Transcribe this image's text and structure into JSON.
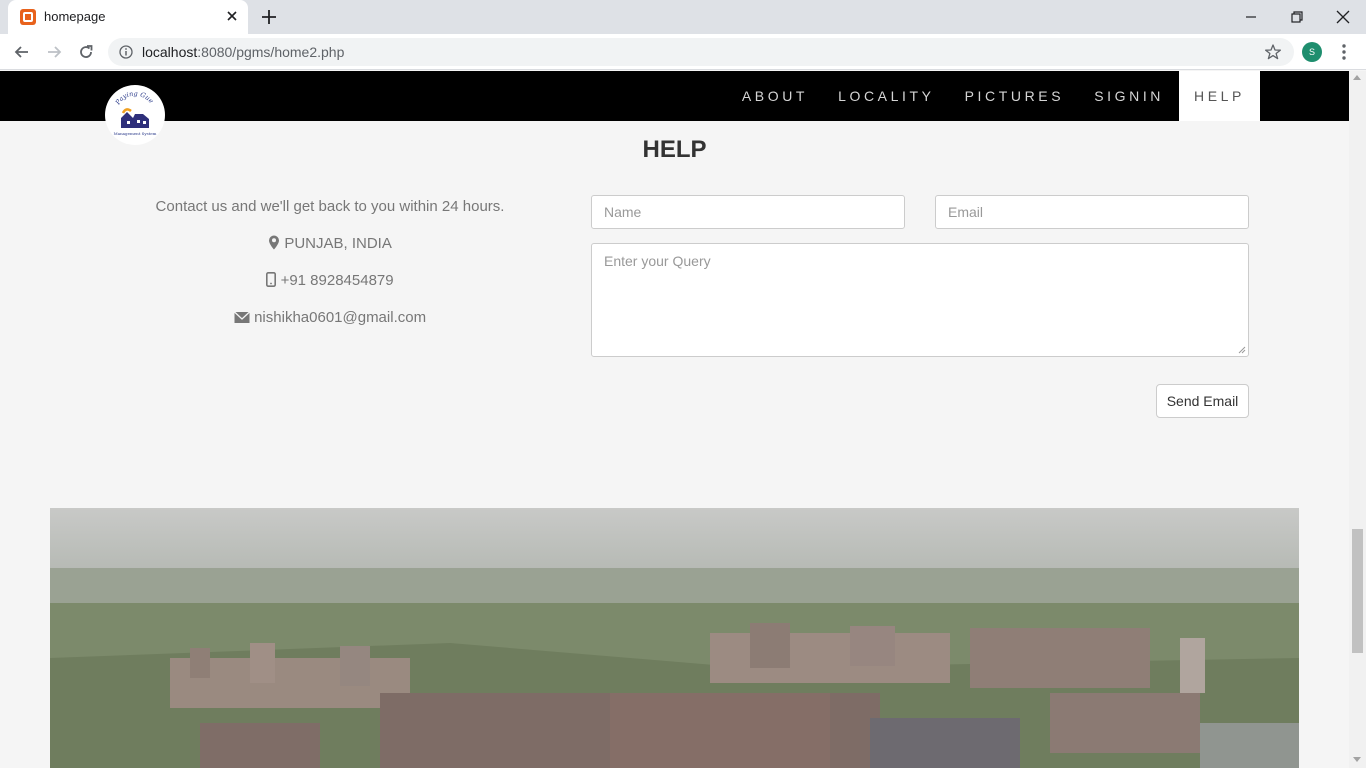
{
  "browser": {
    "tab_title": "homepage",
    "url_host": "localhost",
    "url_rest": ":8080/pgms/home2.php",
    "profile_initial": "S"
  },
  "navbar": {
    "logo_text_top": "Paying Guest",
    "logo_text_bottom": "Management System",
    "links": [
      {
        "label": "ABOUT"
      },
      {
        "label": "LOCALITY"
      },
      {
        "label": "PICTURES"
      },
      {
        "label": "SIGNIN"
      },
      {
        "label": "HELP",
        "active": true
      }
    ]
  },
  "help": {
    "title": "HELP",
    "contact_intro": "Contact us and we'll get back to you within 24 hours.",
    "location": "PUNJAB, INDIA",
    "phone": "+91 8928454879",
    "email": "nishikha0601@gmail.com"
  },
  "form": {
    "name_placeholder": "Name",
    "email_placeholder": "Email",
    "query_placeholder": "Enter your Query",
    "send_label": "Send Email"
  },
  "colors": {
    "navbar_bg": "#000000",
    "page_bg": "#f5f5f5",
    "profile_avatar": "#1e8e6e",
    "favicon": "#e8621c"
  }
}
